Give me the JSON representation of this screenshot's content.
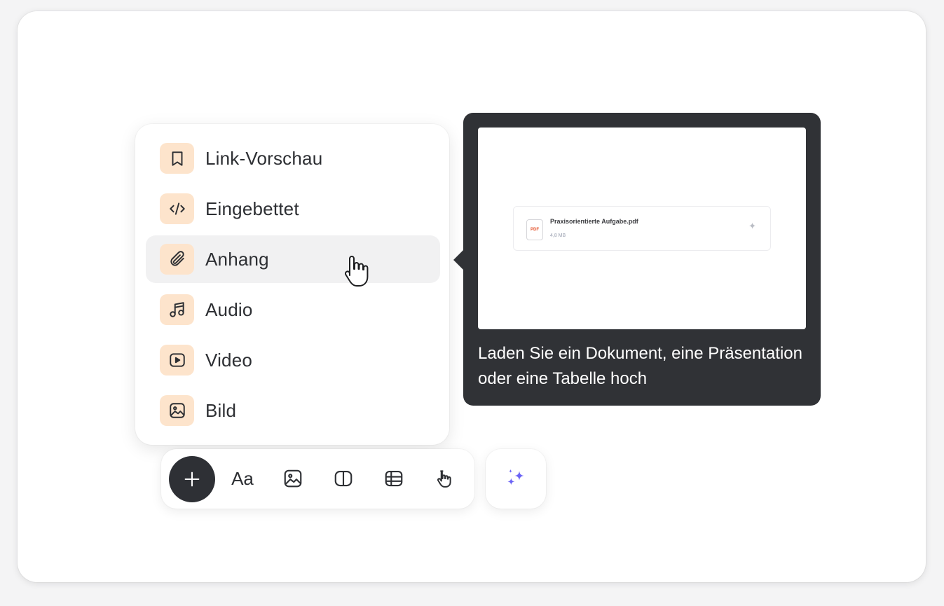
{
  "menu": {
    "items": [
      {
        "label": "Link-Vorschau",
        "icon": "bookmark-icon"
      },
      {
        "label": "Eingebettet",
        "icon": "code-icon"
      },
      {
        "label": "Anhang",
        "icon": "paperclip-icon",
        "active": true
      },
      {
        "label": "Audio",
        "icon": "music-icon"
      },
      {
        "label": "Video",
        "icon": "video-play-icon"
      },
      {
        "label": "Bild",
        "icon": "image-icon"
      }
    ]
  },
  "tooltip": {
    "file_name": "Praxisorientierte Aufgabe.pdf",
    "file_size": "4,8 MB",
    "file_type_badge": "PDF",
    "description": "Laden Sie ein Dokument, eine Präsentation oder eine Tabelle hoch"
  },
  "toolbar": {
    "text_label": "Aa",
    "buttons": [
      "add-icon",
      "text-icon",
      "image-icon",
      "columns-icon",
      "table-icon",
      "pointer-icon"
    ]
  },
  "colors": {
    "icon_bg": "#fde4cc",
    "dark": "#303236",
    "sparkle": "#6b63f6"
  }
}
